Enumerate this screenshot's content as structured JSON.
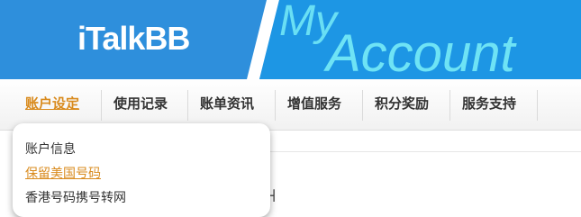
{
  "header": {
    "brand": "iTalkBB",
    "my": "My",
    "account": "Account"
  },
  "nav": {
    "items": [
      {
        "label": "账户设定",
        "active": true
      },
      {
        "label": "使用记录",
        "active": false
      },
      {
        "label": "账单资讯",
        "active": false
      },
      {
        "label": "增值服务",
        "active": false
      },
      {
        "label": "积分奖励",
        "active": false
      },
      {
        "label": "服务支持",
        "active": false
      }
    ]
  },
  "dropdown": {
    "items": [
      {
        "label": "账户信息"
      },
      {
        "label": "保留美国号码"
      },
      {
        "label": "香港号码携号转网"
      }
    ]
  },
  "colors": {
    "header_bg": "#2e8fdc",
    "accent": "#d98b1e",
    "myaccount_text": "#6ee3f5"
  }
}
